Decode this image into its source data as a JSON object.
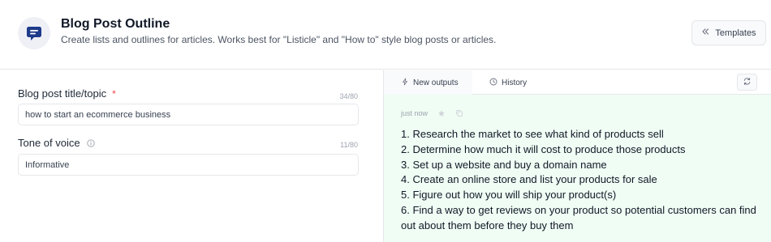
{
  "header": {
    "title": "Blog Post Outline",
    "subtitle": "Create lists and outlines for articles. Works best for \"Listicle\" and \"How to\" style blog posts or articles.",
    "templates_label": "Templates",
    "app_icon": "chat-bubble-icon"
  },
  "form": {
    "title_field": {
      "label": "Blog post title/topic",
      "required_mark": "*",
      "counter": "34/80",
      "value": "how to start an ecommerce business"
    },
    "tone_field": {
      "label": "Tone of voice",
      "info_icon": "info-icon",
      "counter": "11/80",
      "value": "Informative"
    }
  },
  "output_panel": {
    "tabs": [
      {
        "label": "New outputs",
        "icon": "bolt-icon",
        "active": true
      },
      {
        "label": "History",
        "icon": "clock-icon",
        "active": false
      }
    ],
    "refresh_icon": "refresh-icon",
    "timestamp": "just now",
    "star_icon": "star-icon",
    "copy_icon": "copy-icon",
    "items": [
      "1. Research the market to see what kind of products sell",
      "2. Determine how much it will cost to produce those products",
      "3. Set up a website and buy a domain name",
      "4. Create an online store and list your products for sale",
      "5. Figure out how you will ship your product(s)",
      "6. Find a way to get reviews on your product so potential customers can find out about them before they buy them"
    ]
  },
  "colors": {
    "accent": "#1e3a8a",
    "output_bg": "#f0fdf4",
    "required": "#ef4444"
  }
}
